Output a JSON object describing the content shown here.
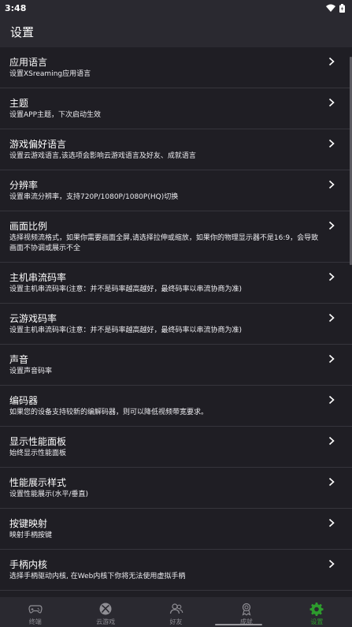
{
  "status_bar": {
    "time": "3:48"
  },
  "app_bar": {
    "title": "设置"
  },
  "settings": [
    {
      "title": "应用语言",
      "desc": "设置XSreaming应用语言"
    },
    {
      "title": "主题",
      "desc": "设置APP主题，下次启动生效"
    },
    {
      "title": "游戏偏好语言",
      "desc": "设置云游戏语言,该选项会影响云游戏语言及好友、成就语言"
    },
    {
      "title": "分辨率",
      "desc": "设置串流分辨率，支持720P/1080P/1080P(HQ)切换"
    },
    {
      "title": "画面比例",
      "desc": "选择视频流格式，如果你需要画面全屏,请选择拉伸或缩放，如果你的物理显示器不是16:9，会导致画面不协调或展示不全"
    },
    {
      "title": "主机串流码率",
      "desc": "设置主机串流码率(注意：并不是码率越高越好，最终码率以串流协商为准)"
    },
    {
      "title": "云游戏码率",
      "desc": "设置主机串流码率(注意：并不是码率越高越好，最终码率以串流协商为准)"
    },
    {
      "title": "声音",
      "desc": "设置声音码率"
    },
    {
      "title": "编码器",
      "desc": "如果您的设备支持较新的编解码器，则可以降低视频带宽要求。"
    },
    {
      "title": "显示性能面板",
      "desc": "始终显示性能面板"
    },
    {
      "title": "性能展示样式",
      "desc": "设置性能展示(水平/垂直)"
    },
    {
      "title": "按键映射",
      "desc": "映射手柄按键"
    },
    {
      "title": "手柄内核",
      "desc": "选择手柄驱动内核, 在Web内核下你将无法使用虚拟手柄"
    }
  ],
  "bottom_nav": {
    "tabs": [
      {
        "label": "终端",
        "icon": "gamepad-icon"
      },
      {
        "label": "云游戏",
        "icon": "xbox-icon"
      },
      {
        "label": "好友",
        "icon": "friends-icon"
      },
      {
        "label": "成就",
        "icon": "achievement-icon"
      },
      {
        "label": "设置",
        "icon": "gear-icon"
      }
    ],
    "active_color": "#2d9c2d",
    "inactive_color": "#8f8e94"
  }
}
